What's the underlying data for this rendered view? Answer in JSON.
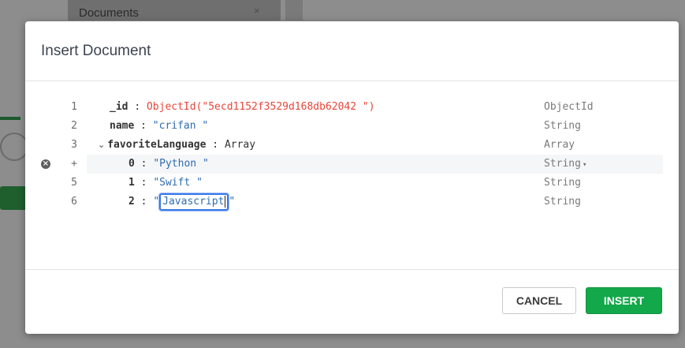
{
  "background": {
    "tab_title": "Documents",
    "tab_close": "×"
  },
  "dialog": {
    "title": "Insert Document"
  },
  "editor": {
    "rows": [
      {
        "line": "1",
        "key": "_id",
        "value": "ObjectId(\"5ecd1152f3529d168db62042 \")",
        "type": "ObjectId"
      },
      {
        "line": "2",
        "key": "name",
        "value": "crifan ",
        "type": "String"
      },
      {
        "line": "3",
        "key": "favoriteLanguage",
        "value": "Array",
        "type": "Array",
        "expand": "⌄"
      },
      {
        "line": "+",
        "key": "0",
        "value": "Python ",
        "type": "String",
        "type_caret": "▾",
        "remove_icon": "×"
      },
      {
        "line": "5",
        "key": "1",
        "value": "Swift ",
        "type": "String"
      },
      {
        "line": "6",
        "key": "2",
        "value": "Javascript",
        "type": "String"
      }
    ],
    "colon": ":",
    "quote": "\""
  },
  "footer": {
    "cancel_label": "CANCEL",
    "insert_label": "INSERT"
  },
  "colors": {
    "insert_button": "#13a84a",
    "object_id": "#e8463a",
    "string_value": "#2f6cb0",
    "focus_border": "#3b78e7"
  }
}
